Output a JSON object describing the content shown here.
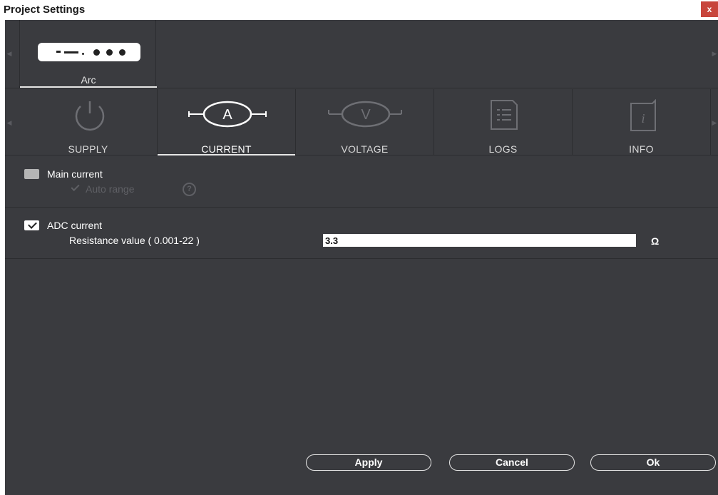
{
  "window": {
    "title": "Project Settings",
    "close_label": "x"
  },
  "device": {
    "name": "Arc",
    "prev_arrow": "◀",
    "next_arrow": "▶"
  },
  "tabs": [
    {
      "label": "SUPPLY",
      "icon": "power-icon",
      "active": false
    },
    {
      "label": "CURRENT",
      "icon": "ammeter-icon",
      "active": true
    },
    {
      "label": "VOLTAGE",
      "icon": "voltmeter-icon",
      "active": false
    },
    {
      "label": "LOGS",
      "icon": "logs-icon",
      "active": false
    },
    {
      "label": "INFO",
      "icon": "info-icon",
      "active": false
    }
  ],
  "main_current": {
    "label": "Main current",
    "checked": false,
    "auto_range_label": "Auto range",
    "help": "?"
  },
  "adc_current": {
    "label": "ADC current",
    "checked": true,
    "resistance_label": "Resistance value ( 0.001-22 )",
    "resistance_value": "3.3",
    "unit": "Ω"
  },
  "buttons": {
    "apply": "Apply",
    "cancel": "Cancel",
    "ok": "Ok"
  }
}
